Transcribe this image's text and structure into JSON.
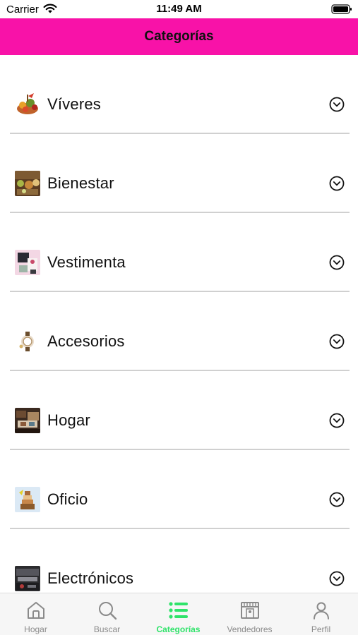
{
  "status": {
    "carrier": "Carrier",
    "time": "11:49 AM"
  },
  "header": {
    "title": "Categorías"
  },
  "categories": [
    {
      "label": "Víveres",
      "icon": "groceries-image"
    },
    {
      "label": "Bienestar",
      "icon": "wellness-image"
    },
    {
      "label": "Vestimenta",
      "icon": "clothing-image"
    },
    {
      "label": "Accesorios",
      "icon": "accessories-image"
    },
    {
      "label": "Hogar",
      "icon": "home-goods-image"
    },
    {
      "label": "Oficio",
      "icon": "crafts-image"
    },
    {
      "label": "Electrónicos",
      "icon": "electronics-image"
    }
  ],
  "tabs": [
    {
      "label": "Hogar",
      "icon": "home-icon",
      "active": false
    },
    {
      "label": "Buscar",
      "icon": "search-icon",
      "active": false
    },
    {
      "label": "Categorías",
      "icon": "list-icon",
      "active": true
    },
    {
      "label": "Vendedores",
      "icon": "store-icon",
      "active": false
    },
    {
      "label": "Perfil",
      "icon": "person-icon",
      "active": false
    }
  ],
  "colors": {
    "header": "#f812a8",
    "active_tab": "#2fe36a",
    "inactive_tab": "#8a8a8a"
  }
}
